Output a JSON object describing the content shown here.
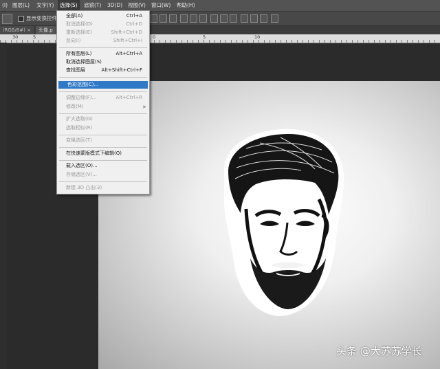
{
  "menubar": {
    "items": [
      "(I)",
      "图层(L)",
      "文字(Y)",
      "选择(S)",
      "滤镜(T)",
      "3D(D)",
      "视图(V)",
      "窗口(W)",
      "帮助(H)"
    ],
    "active": "选择(S)"
  },
  "options_bar": {
    "checkbox_label": "显示变换控件"
  },
  "doc_tabs": [
    "/RGB/8#) ×",
    "头像.p"
  ],
  "ruler_numbers": [
    "30",
    "5",
    "0",
    "5",
    "10"
  ],
  "select_menu": {
    "items": [
      {
        "label": "全部(A)",
        "shortcut": "Ctrl+A",
        "enabled": true
      },
      {
        "label": "取消选择(D)",
        "shortcut": "Ctrl+D",
        "enabled": false
      },
      {
        "label": "重新选择(E)",
        "shortcut": "Shift+Ctrl+D",
        "enabled": false
      },
      {
        "label": "反向(I)",
        "shortcut": "Shift+Ctrl+I",
        "enabled": false
      },
      {
        "label": "所有图层(L)",
        "shortcut": "Alt+Ctrl+A",
        "enabled": true
      },
      {
        "label": "取消选择图层(S)",
        "shortcut": "",
        "enabled": true
      },
      {
        "label": "查找图层",
        "shortcut": "Alt+Shift+Ctrl+F",
        "enabled": true
      },
      {
        "label": "色彩范围(C)...",
        "shortcut": "",
        "enabled": true,
        "highlighted": true
      },
      {
        "label": "调整边缘(F)...",
        "shortcut": "Alt+Ctrl+R",
        "enabled": false
      },
      {
        "label": "修改(M)",
        "shortcut": "",
        "enabled": false,
        "submenu": true
      },
      {
        "label": "扩大选取(G)",
        "shortcut": "",
        "enabled": false
      },
      {
        "label": "选取相似(R)",
        "shortcut": "",
        "enabled": false
      },
      {
        "label": "变换选区(T)",
        "shortcut": "",
        "enabled": false
      },
      {
        "label": "在快速蒙版模式下编辑(Q)",
        "shortcut": "",
        "enabled": true
      },
      {
        "label": "载入选区(O)...",
        "shortcut": "",
        "enabled": true
      },
      {
        "label": "存储选区(V)...",
        "shortcut": "",
        "enabled": false
      },
      {
        "label": "新建 3D 凸出(3)",
        "shortcut": "",
        "enabled": false
      }
    ]
  },
  "watermark": "头条 @大苏苏学长",
  "colors": {
    "menu_highlight": "#2f79c6",
    "ui_dark": "#2b2b2b",
    "menubar": "#535353"
  }
}
